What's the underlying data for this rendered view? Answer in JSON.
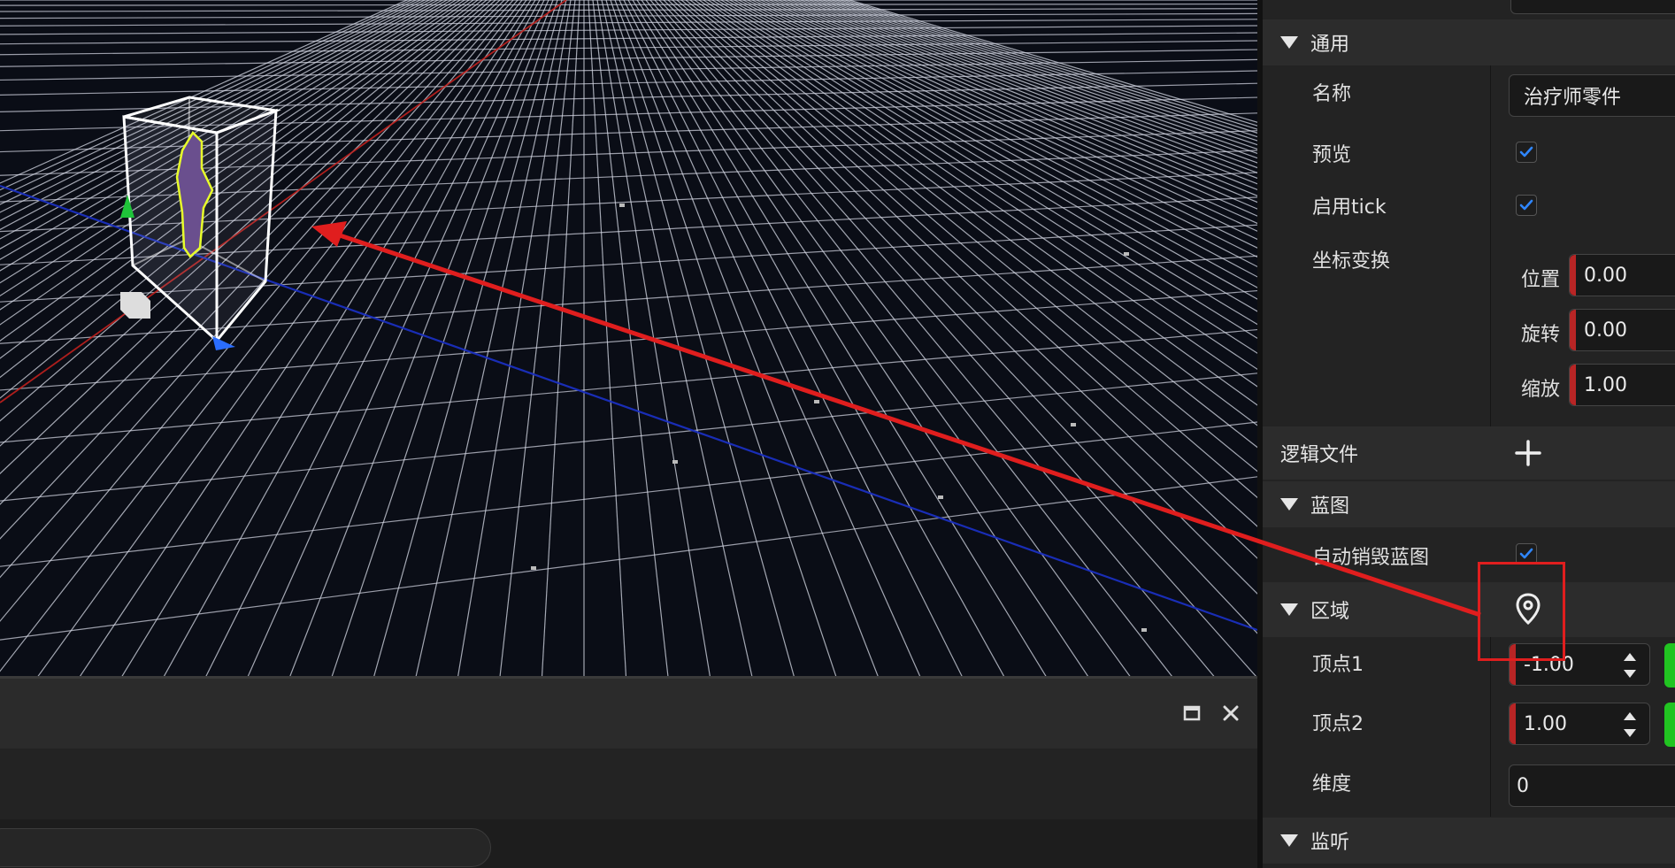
{
  "inspector": {
    "general_section": "通用",
    "name_label": "名称",
    "name_value": "治疗师零件",
    "preview_label": "预览",
    "tick_label": "启用tick",
    "transform_label": "坐标变换",
    "position_label": "位置",
    "position_value": "0.00",
    "rotation_label": "旋转",
    "rotation_value": "0.00",
    "scale_label": "缩放",
    "scale_value": "1.00",
    "logic_files_label": "逻辑文件",
    "blueprint_section": "蓝图",
    "auto_destroy_label": "自动销毁蓝图",
    "region_section": "区域",
    "vertex1_label": "顶点1",
    "vertex1_value": "-1.00",
    "vertex2_label": "顶点2",
    "vertex2_value": "1.00",
    "dimension_label": "维度",
    "dimension_value": "0",
    "listen_section": "监听"
  },
  "checkboxes": {
    "preview": true,
    "tick": true,
    "auto_destroy": true
  },
  "icons": [
    "plus-icon",
    "map-pin-icon",
    "maximize-icon",
    "close-icon",
    "spinner-arrows-icon",
    "check-icon"
  ],
  "colors": {
    "x_axis": "#c0201d",
    "z_axis": "#1a2fbf",
    "annotation": "#e01e1e",
    "selection_outline": "#e8ff2a",
    "green_accent": "#21c421"
  }
}
